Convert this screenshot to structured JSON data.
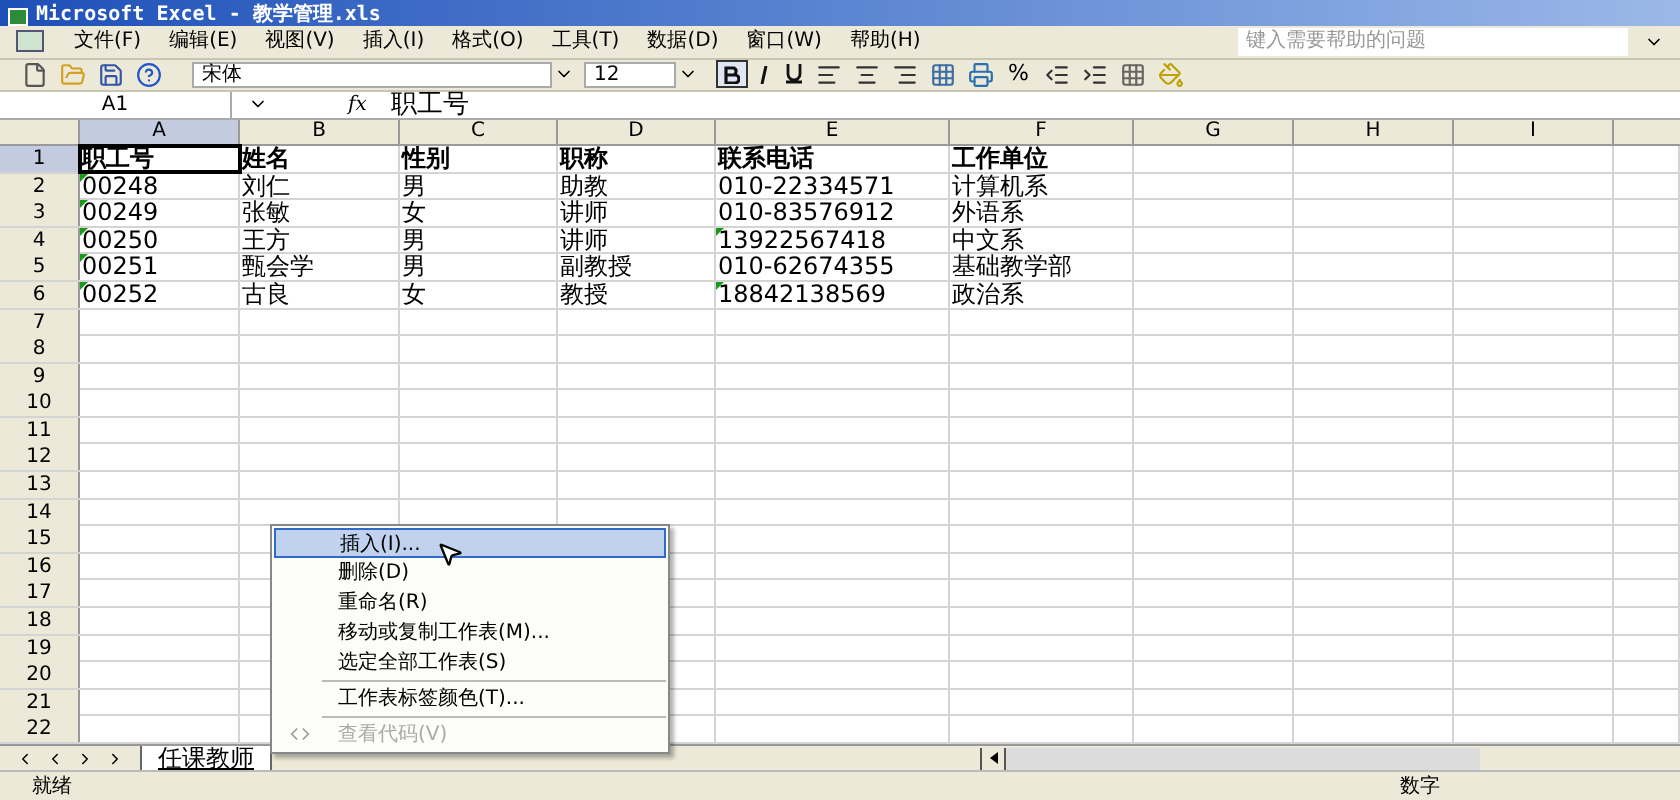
{
  "window": {
    "title": "Microsoft Excel - 教学管理.xls"
  },
  "menu_bar": [
    "文件(F)",
    "编辑(E)",
    "视图(V)",
    "插入(I)",
    "格式(O)",
    "工具(T)",
    "数据(D)",
    "窗口(W)",
    "帮助(H)"
  ],
  "help_box": {
    "placeholder": "键入需要帮助的问题"
  },
  "toolbar": {
    "font": "宋体",
    "size": "12",
    "bold": true,
    "percent": "%"
  },
  "formula_bar": {
    "name_box": "A1",
    "fx": "fx",
    "value": "职工号"
  },
  "columns": [
    {
      "label": "A",
      "selected": true
    },
    {
      "label": "B",
      "selected": false
    },
    {
      "label": "C",
      "selected": false
    },
    {
      "label": "D",
      "selected": false
    },
    {
      "label": "E",
      "selected": false
    },
    {
      "label": "F",
      "selected": false
    },
    {
      "label": "G",
      "selected": false
    },
    {
      "label": "H",
      "selected": false
    },
    {
      "label": "I",
      "selected": false
    }
  ],
  "rows": [
    {
      "number": "1",
      "selected": true,
      "cells": [
        {
          "text": "职工号",
          "flag": false,
          "selected": true
        },
        {
          "text": "姓名",
          "flag": false,
          "selected": false
        },
        {
          "text": "性别",
          "flag": false,
          "selected": false
        },
        {
          "text": "职称",
          "flag": false,
          "selected": false
        },
        {
          "text": "联系电话",
          "flag": false,
          "selected": false
        },
        {
          "text": "工作单位",
          "flag": false,
          "selected": false
        }
      ]
    },
    {
      "number": "2",
      "selected": false,
      "cells": [
        {
          "text": "00248",
          "flag": true,
          "selected": false
        },
        {
          "text": "刘仁",
          "flag": false,
          "selected": false
        },
        {
          "text": "男",
          "flag": false,
          "selected": false
        },
        {
          "text": "助教",
          "flag": false,
          "selected": false
        },
        {
          "text": "010-22334571",
          "flag": false,
          "selected": false
        },
        {
          "text": "计算机系",
          "flag": false,
          "selected": false
        }
      ]
    },
    {
      "number": "3",
      "selected": false,
      "cells": [
        {
          "text": "00249",
          "flag": true,
          "selected": false
        },
        {
          "text": "张敏",
          "flag": false,
          "selected": false
        },
        {
          "text": "女",
          "flag": false,
          "selected": false
        },
        {
          "text": "讲师",
          "flag": false,
          "selected": false
        },
        {
          "text": "010-83576912",
          "flag": false,
          "selected": false
        },
        {
          "text": "外语系",
          "flag": false,
          "selected": false
        }
      ]
    },
    {
      "number": "4",
      "selected": false,
      "cells": [
        {
          "text": "00250",
          "flag": true,
          "selected": false
        },
        {
          "text": "王方",
          "flag": false,
          "selected": false
        },
        {
          "text": "男",
          "flag": false,
          "selected": false
        },
        {
          "text": "讲师",
          "flag": false,
          "selected": false
        },
        {
          "text": "13922567418",
          "flag": true,
          "selected": false
        },
        {
          "text": "中文系",
          "flag": false,
          "selected": false
        }
      ]
    },
    {
      "number": "5",
      "selected": false,
      "cells": [
        {
          "text": "00251",
          "flag": true,
          "selected": false
        },
        {
          "text": "甄会学",
          "flag": false,
          "selected": false
        },
        {
          "text": "男",
          "flag": false,
          "selected": false
        },
        {
          "text": "副教授",
          "flag": false,
          "selected": false
        },
        {
          "text": "010-62674355",
          "flag": false,
          "selected": false
        },
        {
          "text": "基础教学部",
          "flag": false,
          "selected": false
        }
      ]
    },
    {
      "number": "6",
      "selected": false,
      "cells": [
        {
          "text": "00252",
          "flag": true,
          "selected": false
        },
        {
          "text": "古良",
          "flag": false,
          "selected": false
        },
        {
          "text": "女",
          "flag": false,
          "selected": false
        },
        {
          "text": "教授",
          "flag": false,
          "selected": false
        },
        {
          "text": "18842138569",
          "flag": true,
          "selected": false
        },
        {
          "text": "政治系",
          "flag": false,
          "selected": false
        }
      ]
    },
    {
      "number": "7",
      "selected": false,
      "cells": []
    },
    {
      "number": "8",
      "selected": false,
      "cells": []
    },
    {
      "number": "9",
      "selected": false,
      "cells": []
    },
    {
      "number": "10",
      "selected": false,
      "cells": []
    },
    {
      "number": "11",
      "selected": false,
      "cells": []
    },
    {
      "number": "12",
      "selected": false,
      "cells": []
    },
    {
      "number": "13",
      "selected": false,
      "cells": []
    },
    {
      "number": "14",
      "selected": false,
      "cells": []
    },
    {
      "number": "15",
      "selected": false,
      "cells": []
    },
    {
      "number": "16",
      "selected": false,
      "cells": []
    },
    {
      "number": "17",
      "selected": false,
      "cells": []
    },
    {
      "number": "18",
      "selected": false,
      "cells": []
    },
    {
      "number": "19",
      "selected": false,
      "cells": []
    },
    {
      "number": "20",
      "selected": false,
      "cells": []
    },
    {
      "number": "21",
      "selected": false,
      "cells": []
    },
    {
      "number": "22",
      "selected": false,
      "cells": []
    }
  ],
  "sheet_tabs": [
    {
      "label": "任课教师",
      "selected": true
    }
  ],
  "context_menu": [
    {
      "label": "插入(I)...",
      "selected": true,
      "disabled": false,
      "divider_before": false
    },
    {
      "label": "删除(D)",
      "selected": false,
      "disabled": false,
      "divider_before": false
    },
    {
      "label": "重命名(R)",
      "selected": false,
      "disabled": false,
      "divider_before": false
    },
    {
      "label": "移动或复制工作表(M)...",
      "selected": false,
      "disabled": false,
      "divider_before": false
    },
    {
      "label": "选定全部工作表(S)",
      "selected": false,
      "disabled": false,
      "divider_before": false
    },
    {
      "label": "工作表标签颜色(T)...",
      "selected": false,
      "disabled": false,
      "divider_before": true
    },
    {
      "label": "查看代码(V)",
      "selected": false,
      "disabled": true,
      "divider_before": true
    }
  ],
  "status_bar": {
    "left": "就绪",
    "right": "数字"
  }
}
